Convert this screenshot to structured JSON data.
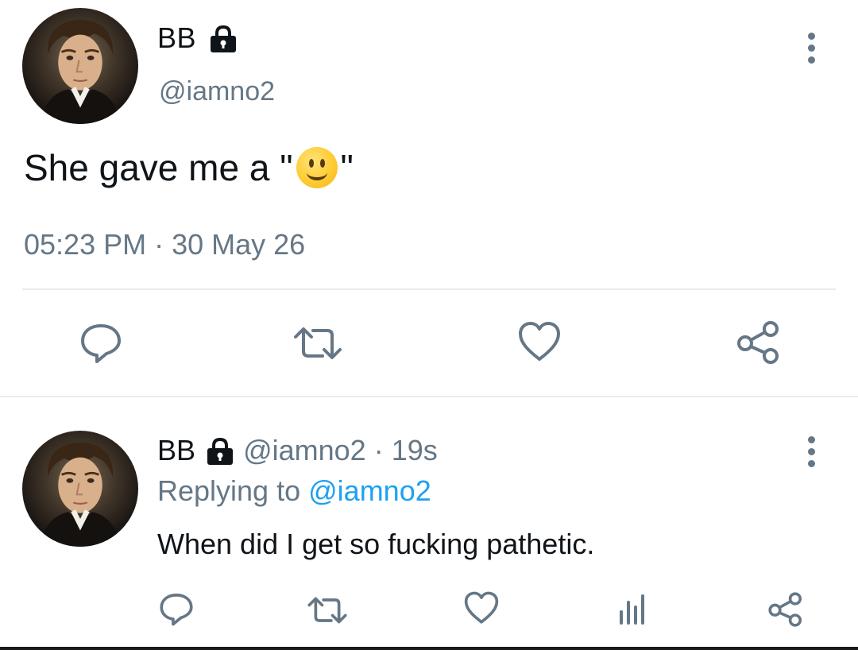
{
  "main_tweet": {
    "name": "BB",
    "handle": "@iamno2",
    "text_before": "She gave me a \"",
    "text_emoji": "smiling-face-emoji",
    "text_after": "\"",
    "timestamp": "05:23 PM · 30 May 26",
    "actions": [
      "reply-icon",
      "retweet-icon",
      "like-icon",
      "share-icon"
    ]
  },
  "reply_tweet": {
    "name": "BB",
    "handle": "@iamno2",
    "separator": "·",
    "time": "19s",
    "replying_prefix": "Replying to",
    "replying_to": "@iamno2",
    "text": "When did I get so fucking pathetic.",
    "actions": [
      "reply-icon",
      "retweet-icon",
      "like-icon",
      "analytics-icon",
      "share-icon"
    ]
  },
  "colors": {
    "text": "#0f1419",
    "secondary": "#657786",
    "link": "#1da1f2",
    "divider": "#e6ecf0"
  }
}
